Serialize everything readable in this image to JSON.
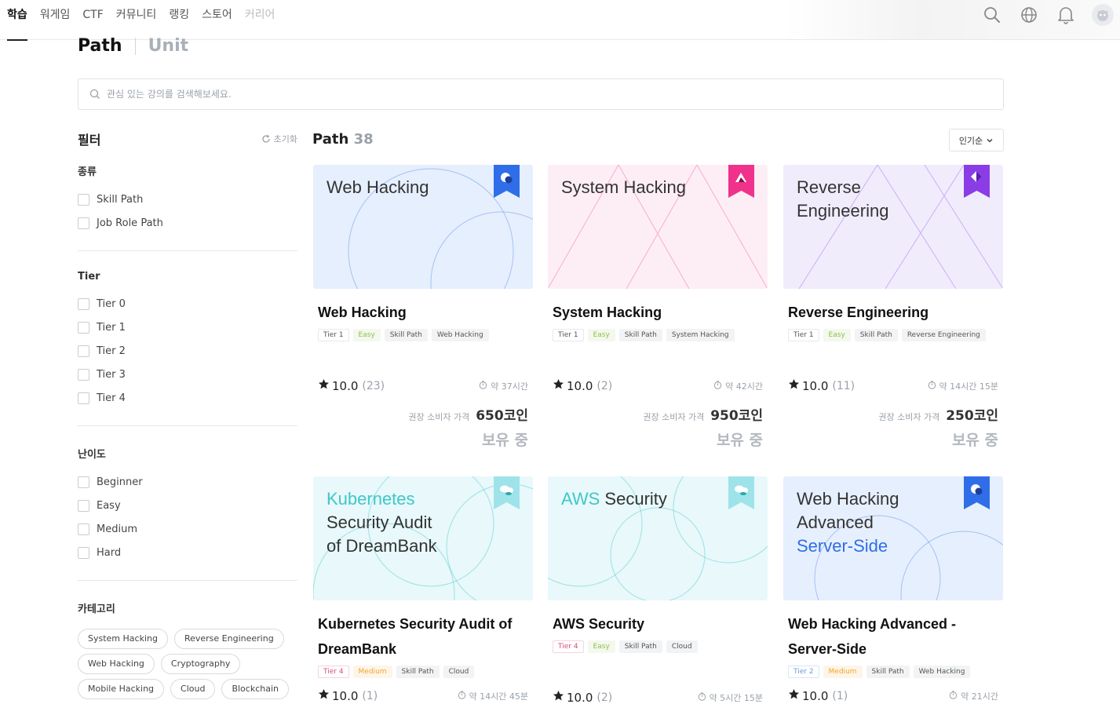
{
  "nav": {
    "tabs": [
      {
        "label": "학습",
        "state": "active"
      },
      {
        "label": "워게임",
        "state": "normal"
      },
      {
        "label": "CTF",
        "state": "normal"
      },
      {
        "label": "커뮤니티",
        "state": "normal"
      },
      {
        "label": "랭킹",
        "state": "normal"
      },
      {
        "label": "스토어",
        "state": "normal"
      },
      {
        "label": "커리어",
        "state": "muted"
      }
    ],
    "icons": [
      "search-icon",
      "globe-icon",
      "bell-icon",
      "avatar"
    ]
  },
  "view_tabs": {
    "path": "Path",
    "unit": "Unit",
    "active": "path"
  },
  "search": {
    "placeholder": "관심 있는 강의를 검색해보세요.",
    "value": ""
  },
  "filter": {
    "title": "필터",
    "reset_label": "초기화",
    "kind": {
      "title": "종류",
      "options": [
        "Skill Path",
        "Job Role Path"
      ]
    },
    "tier": {
      "title": "Tier",
      "options": [
        "Tier 0",
        "Tier 1",
        "Tier 2",
        "Tier 3",
        "Tier 4"
      ]
    },
    "difficulty": {
      "title": "난이도",
      "options": [
        "Beginner",
        "Easy",
        "Medium",
        "Hard"
      ]
    },
    "category": {
      "title": "카테고리",
      "chips": [
        "System Hacking",
        "Reverse Engineering",
        "Web Hacking",
        "Cryptography",
        "Mobile Hacking",
        "Cloud",
        "Blockchain"
      ]
    }
  },
  "listing": {
    "title": "Path",
    "count": "38",
    "sort_label": "인기순"
  },
  "price_label": "권장 소비자 가격",
  "cards": [
    {
      "thumb_lines": [
        "Web Hacking"
      ],
      "thumb_accent": "",
      "accent_color": "#2f6ee8",
      "bg": "#e6effd",
      "theme": "web",
      "title": "Web Hacking",
      "tags": [
        {
          "text": "Tier 1",
          "kind": "t1"
        },
        {
          "text": "Easy",
          "kind": "easy"
        },
        {
          "text": "Skill Path",
          "kind": "gray"
        },
        {
          "text": "Web Hacking",
          "kind": "gray"
        }
      ],
      "rating": "10.0",
      "reviews": "(23)",
      "duration": "약 37시간",
      "price": "650코인",
      "status": "보유 중"
    },
    {
      "thumb_lines": [
        "System Hacking"
      ],
      "thumb_accent": "",
      "accent_color": "#f0328c",
      "bg": "#fdeef5",
      "theme": "system",
      "title": "System Hacking",
      "tags": [
        {
          "text": "Tier 1",
          "kind": "t1"
        },
        {
          "text": "Easy",
          "kind": "easy"
        },
        {
          "text": "Skill Path",
          "kind": "gray"
        },
        {
          "text": "System Hacking",
          "kind": "gray"
        }
      ],
      "rating": "10.0",
      "reviews": "(2)",
      "duration": "약 42시간",
      "price": "950코인",
      "status": "보유 중"
    },
    {
      "thumb_lines": [
        "Reverse",
        "Engineering"
      ],
      "thumb_accent": "",
      "accent_color": "#8a3de6",
      "bg": "#f1ecfc",
      "theme": "reverse",
      "title": "Reverse Engineering",
      "tags": [
        {
          "text": "Tier 1",
          "kind": "t1"
        },
        {
          "text": "Easy",
          "kind": "easy"
        },
        {
          "text": "Skill Path",
          "kind": "gray"
        },
        {
          "text": "Reverse Engineering",
          "kind": "gray"
        }
      ],
      "rating": "10.0",
      "reviews": "(11)",
      "duration": "약 14시간 15분",
      "price": "250코인",
      "status": "보유 중"
    },
    {
      "thumb_lines": [
        "Security Audit",
        "of DreamBank"
      ],
      "thumb_accent": "Kubernetes",
      "accent_color": "#3ec8c8",
      "bg": "#e8f8fb",
      "theme": "cloud",
      "title": "Kubernetes Security Audit of DreamBank",
      "tags": [
        {
          "text": "Tier 4",
          "kind": "t4"
        },
        {
          "text": "Medium",
          "kind": "medium"
        },
        {
          "text": "Skill Path",
          "kind": "gray"
        },
        {
          "text": "Cloud",
          "kind": "gray"
        }
      ],
      "rating": "10.0",
      "reviews": "(1)",
      "duration": "약 14시간 45분",
      "price": "",
      "status": ""
    },
    {
      "thumb_lines": [
        "Security"
      ],
      "thumb_accent": "AWS",
      "accent_color": "#3ec8c8",
      "bg": "#e8f8fb",
      "theme": "cloud2",
      "title": "AWS Security",
      "tags": [
        {
          "text": "Tier 4",
          "kind": "t4"
        },
        {
          "text": "Easy",
          "kind": "easy"
        },
        {
          "text": "Skill Path",
          "kind": "gray"
        },
        {
          "text": "Cloud",
          "kind": "gray"
        }
      ],
      "rating": "10.0",
      "reviews": "(2)",
      "duration": "약 5시간 15분",
      "price": "",
      "status": ""
    },
    {
      "thumb_lines": [
        "Web Hacking",
        "Advanced"
      ],
      "thumb_accent": "Server-Side",
      "accent_color": "#2f6ee8",
      "bg": "#e6effd",
      "theme": "web2",
      "title": "Web Hacking Advanced - Server-Side",
      "tags": [
        {
          "text": "Tier 2",
          "kind": "t2"
        },
        {
          "text": "Medium",
          "kind": "medium"
        },
        {
          "text": "Skill Path",
          "kind": "gray"
        },
        {
          "text": "Web Hacking",
          "kind": "gray"
        }
      ],
      "rating": "10.0",
      "reviews": "(1)",
      "duration": "약 21시간",
      "price": "",
      "status": ""
    }
  ]
}
